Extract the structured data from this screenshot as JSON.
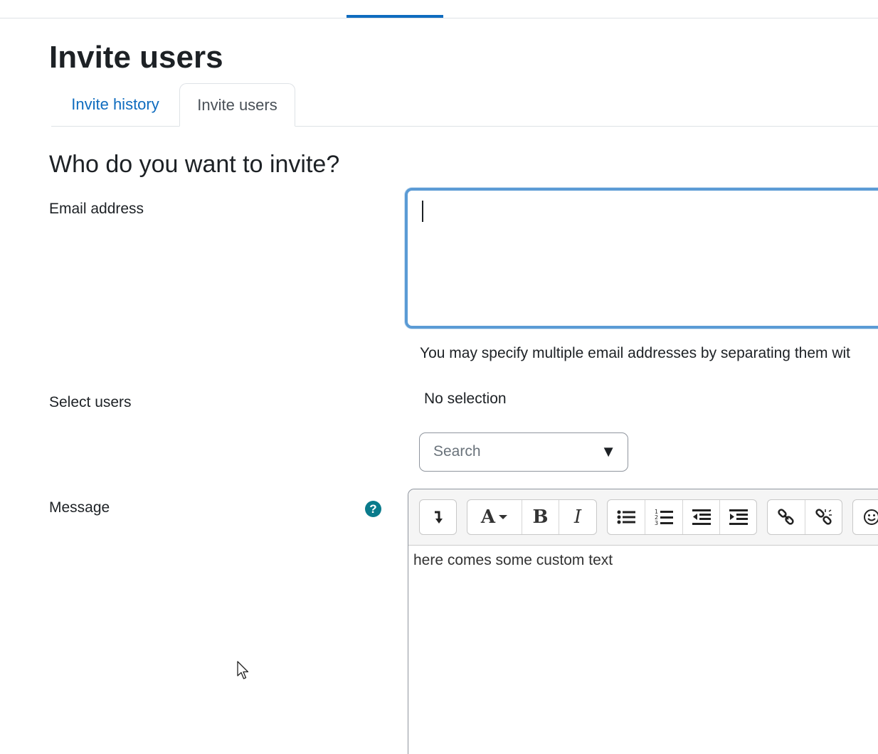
{
  "page": {
    "title": "Invite users"
  },
  "tabs": [
    {
      "label": "Invite history"
    },
    {
      "label": "Invite users"
    }
  ],
  "form": {
    "section_title": "Who do you want to invite?",
    "email_label": "Email address",
    "email_value": "",
    "email_help": "You may specify multiple email addresses by separating them wit",
    "select_users_label": "Select users",
    "no_selection_text": "No selection",
    "search_placeholder": "Search",
    "message_label": "Message",
    "message_text": "here comes some custom text",
    "help_glyph": "?"
  },
  "toolbar": {
    "groups": [
      [
        "collapse-icon"
      ],
      [
        "font-style-icon",
        "bold-icon",
        "italic-icon"
      ],
      [
        "unordered-list-icon",
        "ordered-list-icon",
        "outdent-icon",
        "indent-icon"
      ],
      [
        "link-icon",
        "unlink-icon"
      ],
      [
        "emoji-icon"
      ]
    ],
    "bold_glyph": "B",
    "italic_glyph": "I",
    "font_glyph": "A"
  },
  "colors": {
    "accent": "#0f6cbf",
    "focus_border": "#5b9bd5",
    "help_icon": "#0a7b8c"
  }
}
